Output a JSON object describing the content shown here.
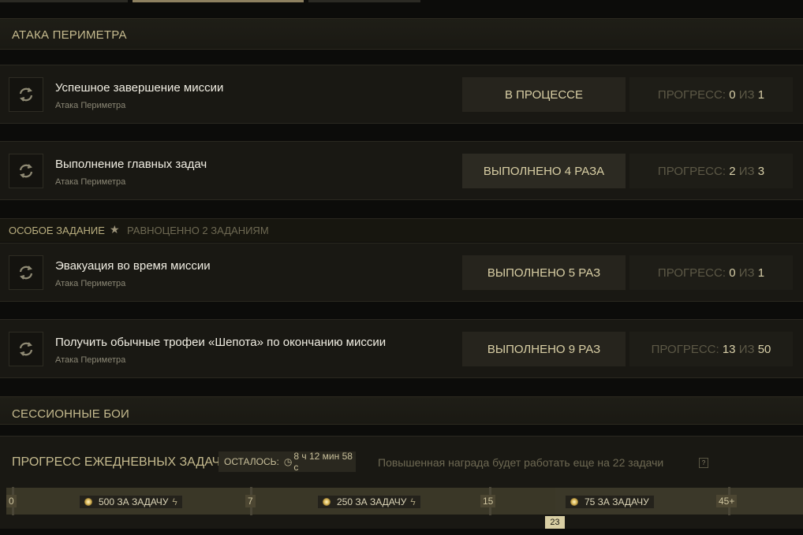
{
  "sections": {
    "perimeter_title": "АТАКА ПЕРИМЕТРА",
    "session_title": "СЕССИОННЫЕ БОИ"
  },
  "tasks": [
    {
      "title": "Успешное завершение миссии",
      "subtitle": "Атака Периметра",
      "status": "В ПРОЦЕССЕ",
      "progress_label": "ПРОГРЕСС:",
      "progress_current": "0",
      "progress_of": "ИЗ",
      "progress_total": "1"
    },
    {
      "title": "Выполнение главных задач",
      "subtitle": "Атака Периметра",
      "status": "ВЫПОЛНЕНО 4 РАЗА",
      "progress_label": "ПРОГРЕСС:",
      "progress_current": "2",
      "progress_of": "ИЗ",
      "progress_total": "3"
    },
    {
      "title": "Эвакуация во время миссии",
      "subtitle": "Атака Периметра",
      "status": "ВЫПОЛНЕНО 5 РАЗ",
      "progress_label": "ПРОГРЕСС:",
      "progress_current": "0",
      "progress_of": "ИЗ",
      "progress_total": "1"
    },
    {
      "title": "Получить обычные трофеи «Шепота» по окончанию миссии",
      "subtitle": "Атака Периметра",
      "status": "ВЫПОЛНЕНО 9 РАЗ",
      "progress_label": "ПРОГРЕСС:",
      "progress_current": "13",
      "progress_of": "ИЗ",
      "progress_total": "50"
    }
  ],
  "special": {
    "label": "ОСОБОЕ ЗАДАНИЕ",
    "icon": "star-icon",
    "equivalent": "РАВНОЦЕННО 2 ЗАДАНИЯМ"
  },
  "daily": {
    "title": "ПРОГРЕСС ЕЖЕДНЕВНЫХ ЗАДАЧ",
    "remaining_label": "ОСТАЛОСЬ:",
    "remaining_time": "8 ч 12 мин 58 с",
    "bonus_note": "Повышенная награда будет работать еще на 22 задачи",
    "help": "?",
    "current_value": "23",
    "progress_fraction": 0.5,
    "ticks": [
      "0",
      "7",
      "15",
      "45+"
    ],
    "rewards": [
      {
        "label": "500 ЗА ЗАДАЧУ",
        "boosted": true
      },
      {
        "label": "250 ЗА ЗАДАЧУ",
        "boosted": true
      },
      {
        "label": "75 ЗА ЗАДАЧУ",
        "boosted": false
      }
    ]
  },
  "colors": {
    "accent": "#c6bb8f",
    "track_filled": "#3a3727",
    "track_empty": "#3b3829",
    "special_highlight": "#b9ae7f"
  }
}
